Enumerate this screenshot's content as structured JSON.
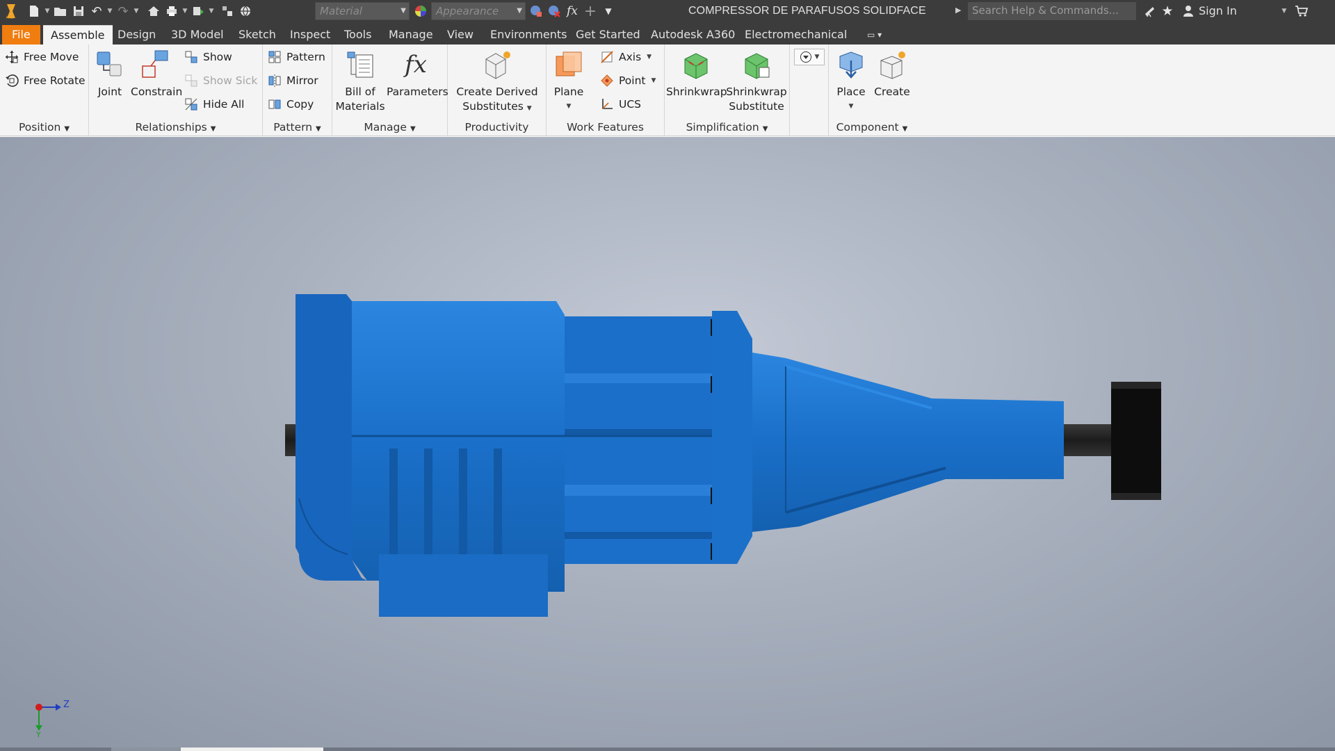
{
  "title_bar": {
    "document_title": "COMPRESSOR DE PARAFUSOS SOLIDFACE",
    "material_placeholder": "Material",
    "appearance_placeholder": "Appearance",
    "search_placeholder": "Search Help & Commands...",
    "sign_in_label": "Sign In"
  },
  "tabs": [
    {
      "label": "File"
    },
    {
      "label": "Assemble"
    },
    {
      "label": "Design"
    },
    {
      "label": "3D Model"
    },
    {
      "label": "Sketch"
    },
    {
      "label": "Inspect"
    },
    {
      "label": "Tools"
    },
    {
      "label": "Manage"
    },
    {
      "label": "View"
    },
    {
      "label": "Environments"
    },
    {
      "label": "Get Started"
    },
    {
      "label": "Autodesk A360"
    },
    {
      "label": "Electromechanical"
    }
  ],
  "active_tab": "Assemble",
  "ribbon": {
    "position": {
      "title": "Position",
      "free_move": "Free Move",
      "free_rotate": "Free Rotate"
    },
    "relationships": {
      "title": "Relationships",
      "joint": "Joint",
      "constrain": "Constrain",
      "show": "Show",
      "show_sick": "Show Sick",
      "hide_all": "Hide All"
    },
    "pattern": {
      "title": "Pattern",
      "pattern": "Pattern",
      "mirror": "Mirror",
      "copy": "Copy"
    },
    "manage": {
      "title": "Manage",
      "bom_line1": "Bill of",
      "bom_line2": "Materials",
      "parameters": "Parameters"
    },
    "productivity": {
      "title": "Productivity",
      "derived_line1": "Create Derived",
      "derived_line2": "Substitutes"
    },
    "work_features": {
      "title": "Work Features",
      "plane": "Plane",
      "axis": "Axis",
      "point": "Point",
      "ucs": "UCS"
    },
    "simplification": {
      "title": "Simplification",
      "shrinkwrap": "Shrinkwrap",
      "sw_sub_line1": "Shrinkwrap",
      "sw_sub_line2": "Substitute"
    },
    "component": {
      "title": "Component",
      "place": "Place",
      "create": "Create"
    }
  },
  "triad": {
    "z_label": "Z",
    "y_label": "Y"
  },
  "colors": {
    "accent_file": "#f07d0f",
    "model_blue": "#1a6fc8",
    "dark_bar": "#3c3c3c",
    "ribbon_bg": "#f4f4f4"
  },
  "icons": {
    "free_move": "move-arrows-icon",
    "free_rotate": "rotate-icon",
    "joint": "joint-icon",
    "constrain": "constraint-icon",
    "pattern": "pattern-grid-icon",
    "mirror": "mirror-icon",
    "copy": "copy-icon",
    "bom": "bill-of-materials-icon",
    "parameters": "fx-icon",
    "plane": "plane-icon",
    "axis": "axis-icon",
    "point": "point-icon",
    "ucs": "ucs-icon",
    "place": "place-component-icon",
    "create": "create-component-icon"
  }
}
